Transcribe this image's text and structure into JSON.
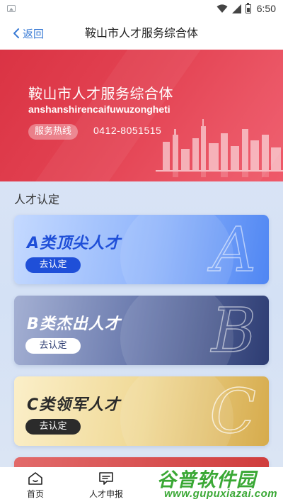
{
  "status_bar": {
    "time": "6:50"
  },
  "nav": {
    "back_label": "返回",
    "title": "鞍山市人才服务综合体"
  },
  "hero": {
    "title": "鞍山市人才服务综合体",
    "pinyin": "anshanshirencaifuwuzongheti",
    "hotline_label": "服务热线",
    "hotline_number": "0412-8051515"
  },
  "section": {
    "title": "人才认定"
  },
  "cards": [
    {
      "title": "A类顶尖人才",
      "button": "去认定",
      "letter": "A"
    },
    {
      "title": "B类杰出人才",
      "button": "去认定",
      "letter": "B"
    },
    {
      "title": "C类领军人才",
      "button": "去认定",
      "letter": "C"
    }
  ],
  "tabs": [
    {
      "label": "首页",
      "icon": "home-icon"
    },
    {
      "label": "人才申报",
      "icon": "message-icon"
    }
  ],
  "watermark": {
    "text": "谷普软件园",
    "url": "www.gupuxiazai.com"
  },
  "colors": {
    "accent": "#3a7bd5",
    "hero_red": "#d9293a",
    "card_a": "#4f86f3",
    "card_b": "#2d3c72",
    "card_c": "#d6ab4c"
  }
}
